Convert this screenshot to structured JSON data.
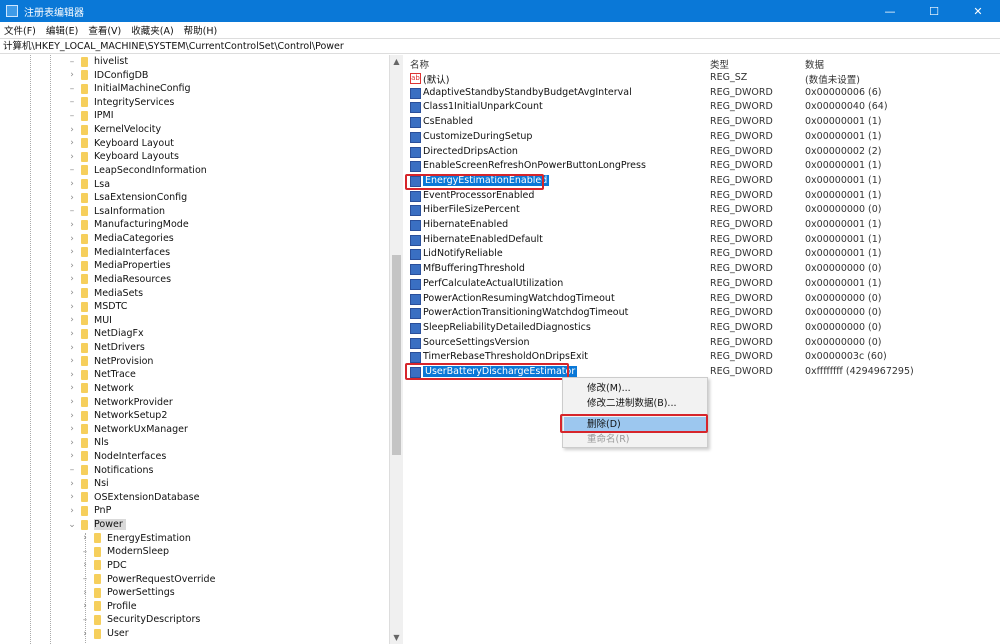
{
  "window": {
    "title": "注册表编辑器",
    "minimize": "—",
    "maximize": "☐",
    "close": "✕"
  },
  "menu": [
    "文件(F)",
    "编辑(E)",
    "查看(V)",
    "收藏夹(A)",
    "帮助(H)"
  ],
  "address": "计算机\\HKEY_LOCAL_MACHINE\\SYSTEM\\CurrentControlSet\\Control\\Power",
  "tree": [
    {
      "label": "hivelist",
      "exp": false,
      "level": 0
    },
    {
      "label": "IDConfigDB",
      "exp": true,
      "level": 0
    },
    {
      "label": "InitialMachineConfig",
      "exp": false,
      "level": 0
    },
    {
      "label": "IntegrityServices",
      "exp": false,
      "level": 0
    },
    {
      "label": "IPMI",
      "exp": false,
      "level": 0
    },
    {
      "label": "KernelVelocity",
      "exp": true,
      "level": 0
    },
    {
      "label": "Keyboard Layout",
      "exp": true,
      "level": 0
    },
    {
      "label": "Keyboard Layouts",
      "exp": true,
      "level": 0
    },
    {
      "label": "LeapSecondInformation",
      "exp": false,
      "level": 0
    },
    {
      "label": "Lsa",
      "exp": true,
      "level": 0
    },
    {
      "label": "LsaExtensionConfig",
      "exp": true,
      "level": 0
    },
    {
      "label": "LsaInformation",
      "exp": false,
      "level": 0
    },
    {
      "label": "ManufacturingMode",
      "exp": true,
      "level": 0
    },
    {
      "label": "MediaCategories",
      "exp": true,
      "level": 0
    },
    {
      "label": "MediaInterfaces",
      "exp": true,
      "level": 0
    },
    {
      "label": "MediaProperties",
      "exp": true,
      "level": 0
    },
    {
      "label": "MediaResources",
      "exp": true,
      "level": 0
    },
    {
      "label": "MediaSets",
      "exp": true,
      "level": 0
    },
    {
      "label": "MSDTC",
      "exp": true,
      "level": 0
    },
    {
      "label": "MUI",
      "exp": true,
      "level": 0
    },
    {
      "label": "NetDiagFx",
      "exp": true,
      "level": 0
    },
    {
      "label": "NetDrivers",
      "exp": true,
      "level": 0
    },
    {
      "label": "NetProvision",
      "exp": true,
      "level": 0
    },
    {
      "label": "NetTrace",
      "exp": true,
      "level": 0
    },
    {
      "label": "Network",
      "exp": true,
      "level": 0
    },
    {
      "label": "NetworkProvider",
      "exp": true,
      "level": 0
    },
    {
      "label": "NetworkSetup2",
      "exp": true,
      "level": 0
    },
    {
      "label": "NetworkUxManager",
      "exp": true,
      "level": 0
    },
    {
      "label": "Nls",
      "exp": true,
      "level": 0
    },
    {
      "label": "NodeInterfaces",
      "exp": true,
      "level": 0
    },
    {
      "label": "Notifications",
      "exp": false,
      "level": 0
    },
    {
      "label": "Nsi",
      "exp": true,
      "level": 0
    },
    {
      "label": "OSExtensionDatabase",
      "exp": true,
      "level": 0
    },
    {
      "label": "PnP",
      "exp": true,
      "level": 0
    },
    {
      "label": "Power",
      "exp": "open",
      "level": 0,
      "selected": true
    },
    {
      "label": "EnergyEstimation",
      "exp": true,
      "level": 1
    },
    {
      "label": "ModernSleep",
      "exp": false,
      "level": 1
    },
    {
      "label": "PDC",
      "exp": true,
      "level": 1
    },
    {
      "label": "PowerRequestOverride",
      "exp": false,
      "level": 1
    },
    {
      "label": "PowerSettings",
      "exp": true,
      "level": 1
    },
    {
      "label": "Profile",
      "exp": true,
      "level": 1
    },
    {
      "label": "SecurityDescriptors",
      "exp": false,
      "level": 1
    },
    {
      "label": "User",
      "exp": true,
      "level": 1
    }
  ],
  "columns": {
    "name": "名称",
    "type": "类型",
    "data": "数据"
  },
  "values": [
    {
      "name": "(默认)",
      "type": "REG_SZ",
      "data": "(数值未设置)",
      "icon": "ab"
    },
    {
      "name": "AdaptiveStandbyStandbyBudgetAvgInterval",
      "type": "REG_DWORD",
      "data": "0x00000006 (6)"
    },
    {
      "name": "Class1InitialUnparkCount",
      "type": "REG_DWORD",
      "data": "0x00000040 (64)"
    },
    {
      "name": "CsEnabled",
      "type": "REG_DWORD",
      "data": "0x00000001 (1)"
    },
    {
      "name": "CustomizeDuringSetup",
      "type": "REG_DWORD",
      "data": "0x00000001 (1)"
    },
    {
      "name": "DirectedDripsAction",
      "type": "REG_DWORD",
      "data": "0x00000002 (2)"
    },
    {
      "name": "EnableScreenRefreshOnPowerButtonLongPress",
      "type": "REG_DWORD",
      "data": "0x00000001 (1)"
    },
    {
      "name": "EnergyEstimationEnabled",
      "type": "REG_DWORD",
      "data": "0x00000001 (1)",
      "highlight": true
    },
    {
      "name": "EventProcessorEnabled",
      "type": "REG_DWORD",
      "data": "0x00000001 (1)"
    },
    {
      "name": "HiberFileSizePercent",
      "type": "REG_DWORD",
      "data": "0x00000000 (0)"
    },
    {
      "name": "HibernateEnabled",
      "type": "REG_DWORD",
      "data": "0x00000001 (1)"
    },
    {
      "name": "HibernateEnabledDefault",
      "type": "REG_DWORD",
      "data": "0x00000001 (1)"
    },
    {
      "name": "LidNotifyReliable",
      "type": "REG_DWORD",
      "data": "0x00000001 (1)"
    },
    {
      "name": "MfBufferingThreshold",
      "type": "REG_DWORD",
      "data": "0x00000000 (0)"
    },
    {
      "name": "PerfCalculateActualUtilization",
      "type": "REG_DWORD",
      "data": "0x00000001 (1)"
    },
    {
      "name": "PowerActionResumingWatchdogTimeout",
      "type": "REG_DWORD",
      "data": "0x00000000 (0)"
    },
    {
      "name": "PowerActionTransitioningWatchdogTimeout",
      "type": "REG_DWORD",
      "data": "0x00000000 (0)"
    },
    {
      "name": "SleepReliabilityDetailedDiagnostics",
      "type": "REG_DWORD",
      "data": "0x00000000 (0)"
    },
    {
      "name": "SourceSettingsVersion",
      "type": "REG_DWORD",
      "data": "0x00000000 (0)"
    },
    {
      "name": "TimerRebaseThresholdOnDripsExit",
      "type": "REG_DWORD",
      "data": "0x0000003c (60)"
    },
    {
      "name": "UserBatteryDischargeEstimator",
      "type": "REG_DWORD",
      "data": "0xffffffff (4294967295)",
      "highlight": true
    }
  ],
  "context_menu": {
    "modify": "修改(M)...",
    "modify_binary": "修改二进制数据(B)...",
    "delete": "删除(D)",
    "rename": "重命名(R)"
  }
}
